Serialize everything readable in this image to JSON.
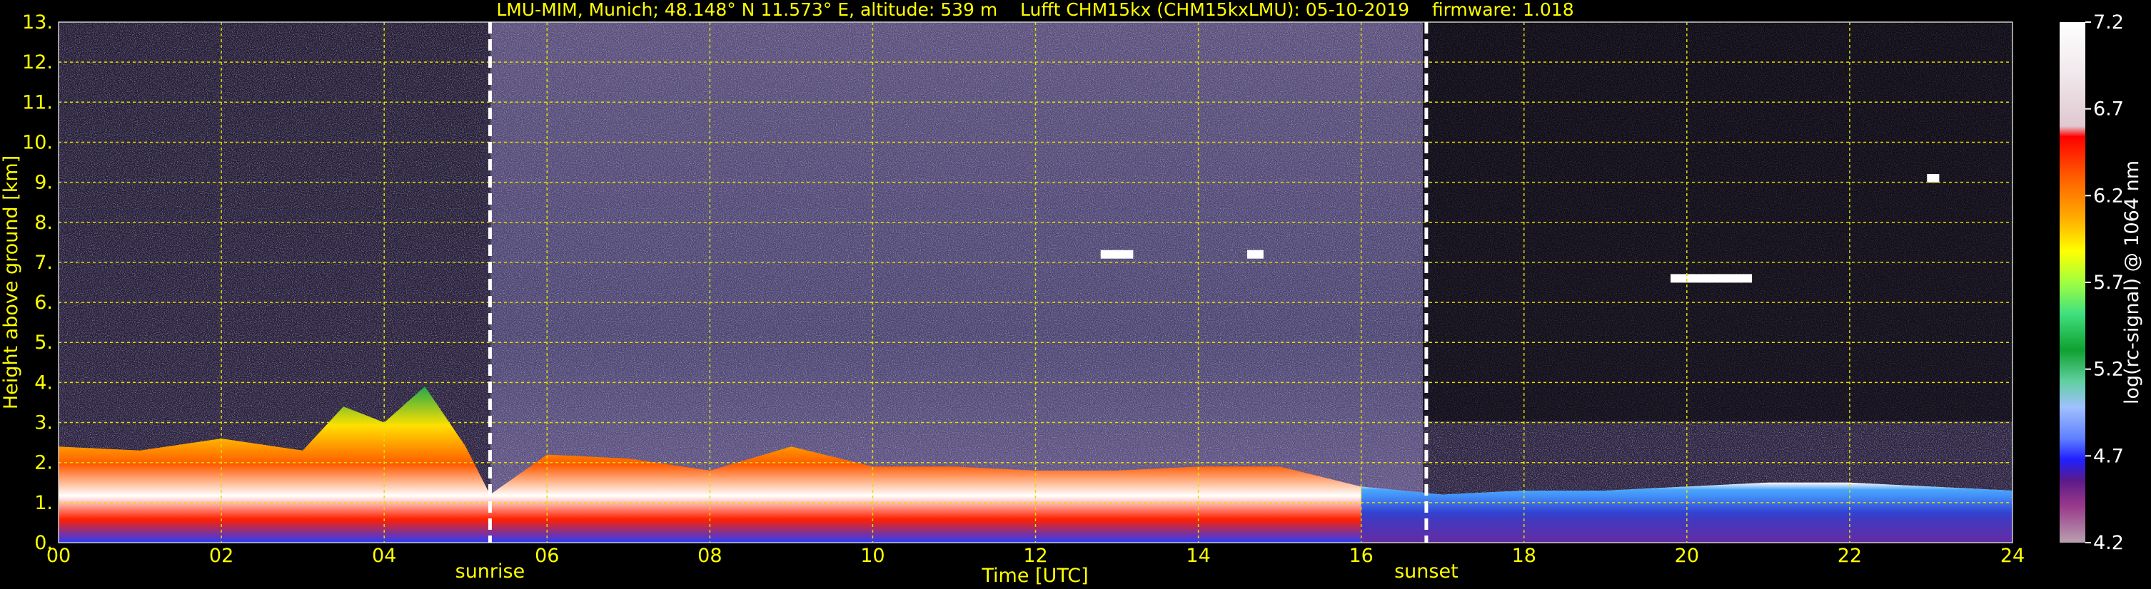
{
  "chart_data": {
    "type": "heatmap",
    "title": "LMU-MIM, Munich; 48.148° N 11.573° E, altitude: 539 m    Lufft CHM15kx (CHM15kxLMU): 05-10-2019    firmware: 1.018",
    "xlabel": "Time [UTC]",
    "ylabel": "Height above ground [km]",
    "xlim": [
      0,
      24
    ],
    "ylim": [
      0,
      13
    ],
    "x_ticks": [
      "00",
      "02",
      "04",
      "06",
      "08",
      "10",
      "12",
      "14",
      "16",
      "18",
      "20",
      "22",
      "24"
    ],
    "y_ticks": [
      "0.",
      "1.",
      "2.",
      "3.",
      "4.",
      "5.",
      "6.",
      "7.",
      "8.",
      "9.",
      "10.",
      "11.",
      "12.",
      "13."
    ],
    "grid": true,
    "annotations": [
      {
        "text": "sunrise",
        "x": 5.3
      },
      {
        "text": "sunset",
        "x": 16.8
      }
    ],
    "colorbar": {
      "label": "log(rc-signal) @ 1064 nm",
      "range": [
        4.2,
        7.2
      ],
      "ticks": [
        "7.2",
        "6.7",
        "6.2",
        "5.7",
        "5.2",
        "4.7",
        "4.2"
      ]
    },
    "boundary_layer_top_km": [
      [
        0,
        2.4
      ],
      [
        1,
        2.3
      ],
      [
        2,
        2.6
      ],
      [
        3,
        2.3
      ],
      [
        3.5,
        3.4
      ],
      [
        4,
        3.0
      ],
      [
        4.5,
        3.9
      ],
      [
        5,
        2.4
      ],
      [
        5.3,
        1.2
      ],
      [
        6,
        2.2
      ],
      [
        7,
        2.1
      ],
      [
        8,
        1.8
      ],
      [
        9,
        2.4
      ],
      [
        10,
        1.9
      ],
      [
        11,
        1.9
      ],
      [
        12,
        1.8
      ],
      [
        13,
        1.8
      ],
      [
        14,
        1.9
      ],
      [
        15,
        1.9
      ],
      [
        16,
        1.4
      ],
      [
        17,
        1.2
      ],
      [
        18,
        1.3
      ],
      [
        19,
        1.3
      ],
      [
        20,
        1.4
      ],
      [
        21,
        1.5
      ],
      [
        22,
        1.5
      ],
      [
        23,
        1.4
      ],
      [
        24,
        1.3
      ]
    ],
    "cloud_layers": [
      {
        "x_start": 12.8,
        "x_end": 13.2,
        "height_km": 7.2
      },
      {
        "x_start": 14.6,
        "x_end": 14.8,
        "height_km": 7.2
      },
      {
        "x_start": 19.8,
        "x_end": 20.8,
        "height_km": 6.6
      },
      {
        "x_start": 22.95,
        "x_end": 23.1,
        "height_km": 9.1
      }
    ]
  }
}
